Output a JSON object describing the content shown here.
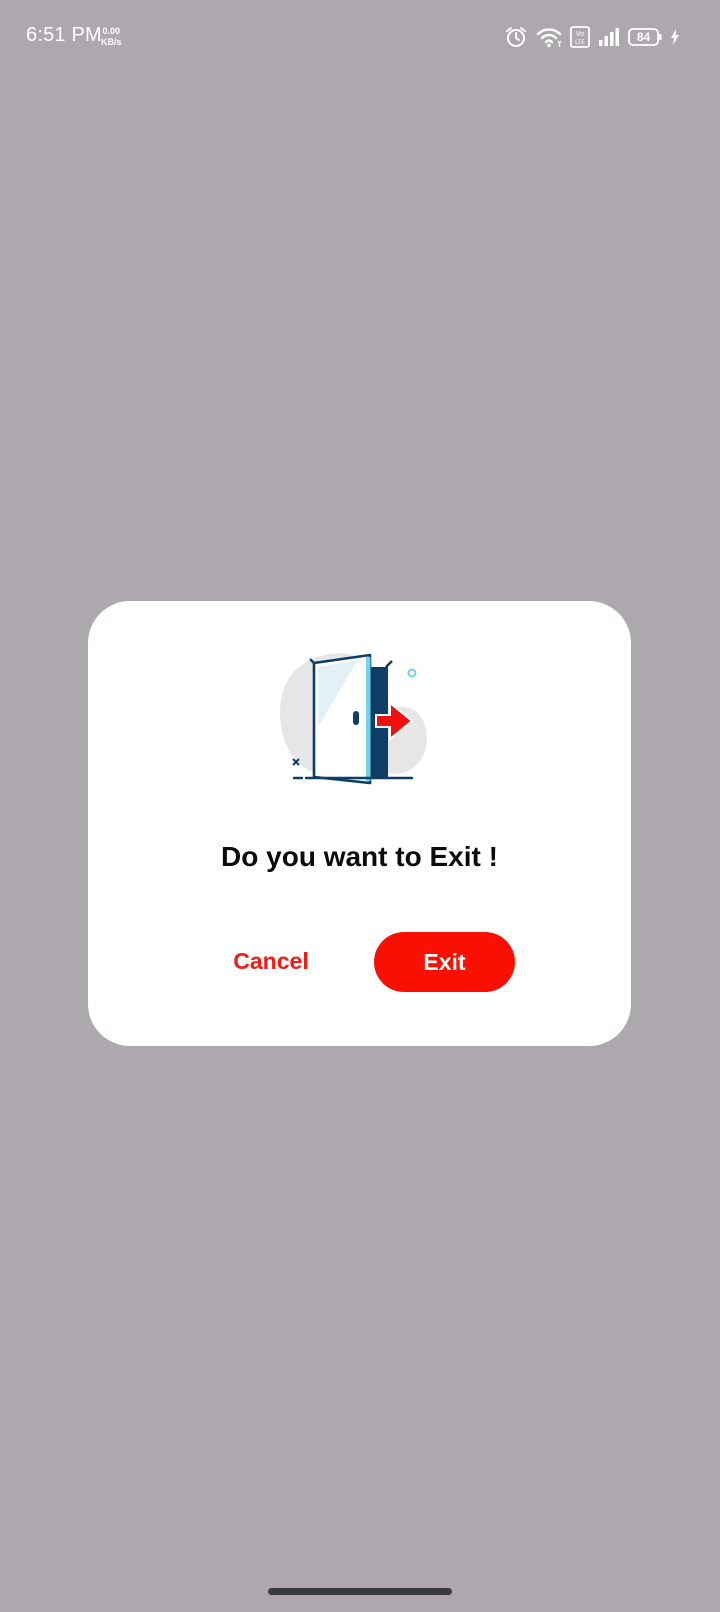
{
  "status_bar": {
    "time": "6:51 PM",
    "net_speed_value": "0.00",
    "net_speed_unit": "KB/s",
    "icons": [
      "alarm-icon",
      "wifi-icon",
      "volte-icon",
      "signal-icon",
      "battery-icon",
      "charging-icon"
    ],
    "battery_level": "84"
  },
  "dialog": {
    "illustration_icon": "exit-door-icon",
    "title": "Do you want to Exit !",
    "cancel_label": "Cancel",
    "exit_label": "Exit"
  },
  "colors": {
    "scrim": "#aca8ad",
    "dialog_bg": "#ffffff",
    "accent_red": "#fa1002",
    "cancel_text": "#f21c14",
    "door_navy": "#0e3d66",
    "door_glass": "#6fd3ea"
  }
}
